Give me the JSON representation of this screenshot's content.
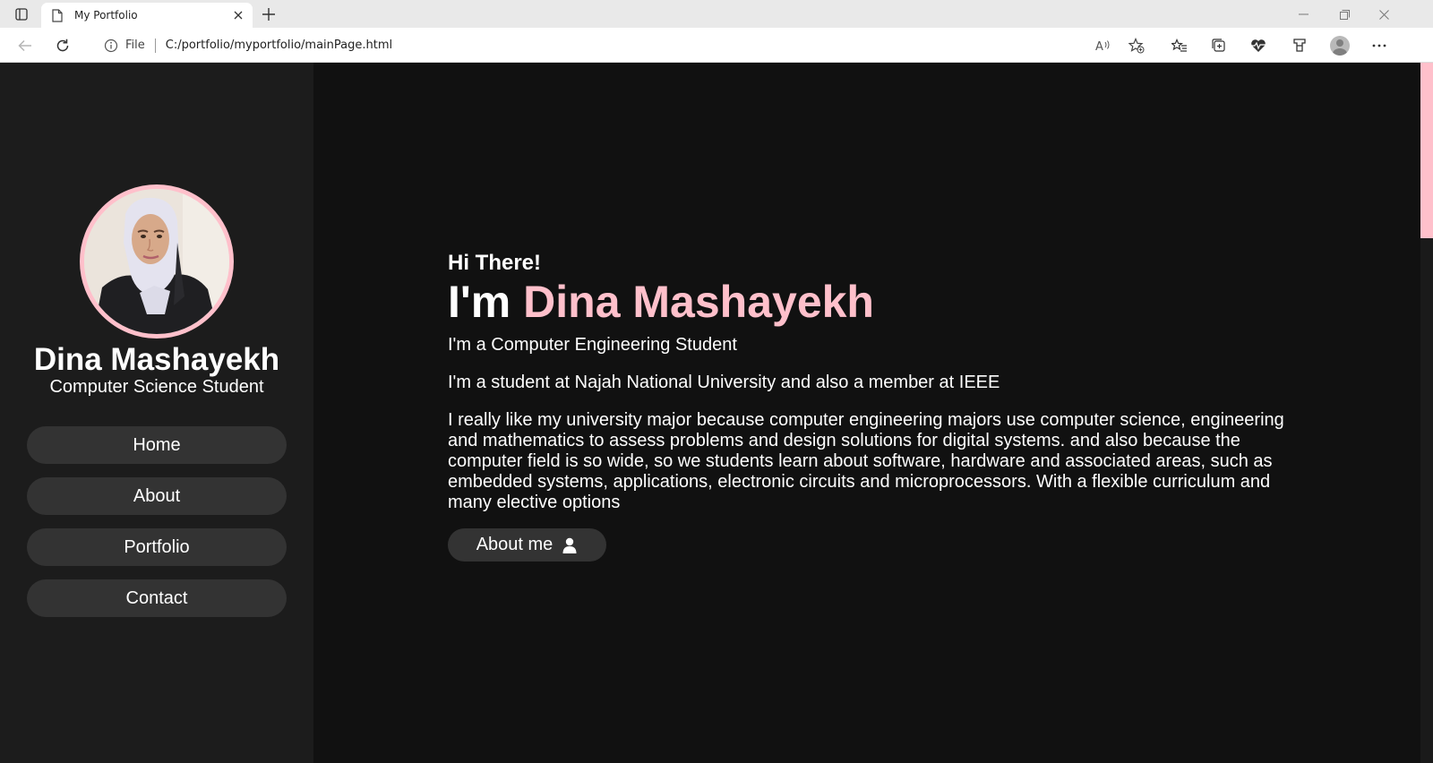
{
  "browser": {
    "tab_title": "My Portfolio",
    "url_scheme": "File",
    "url": "C:/portfolio/myportfolio/mainPage.html"
  },
  "sidebar": {
    "name": "Dina Mashayekh",
    "role": "Computer Science Student",
    "nav": [
      {
        "label": "Home"
      },
      {
        "label": "About"
      },
      {
        "label": "Portfolio"
      },
      {
        "label": "Contact"
      }
    ]
  },
  "hero": {
    "greeting": "Hi There!",
    "im_prefix": "I'm",
    "name": "Dina Mashayekh",
    "line1": "I'm a Computer Engineering Student",
    "line2": "I'm a student at Najah National University and also a member at IEEE",
    "line3": "I really like my university major because computer engineering majors use computer science, engineering and mathematics to assess problems and design solutions for digital systems. and also because the computer field is so wide, so we students learn about software, hardware and associated areas, such as embedded systems, applications, electronic circuits and microprocessors. With a flexible curriculum and many elective options",
    "about_button": "About me"
  },
  "colors": {
    "accent": "#ffc0cb",
    "background": "#111111",
    "sidebar": "#1c1c1c",
    "button": "#333333"
  },
  "icons": [
    "tab-actions-icon",
    "document-icon",
    "close-icon",
    "plus-icon",
    "minimize-icon",
    "restore-icon",
    "back-icon",
    "refresh-icon",
    "info-icon",
    "read-aloud-icon",
    "add-favorite-icon",
    "favorites-icon",
    "collections-icon",
    "health-icon",
    "extensions-icon",
    "profile-icon",
    "more-icon",
    "user-icon"
  ]
}
